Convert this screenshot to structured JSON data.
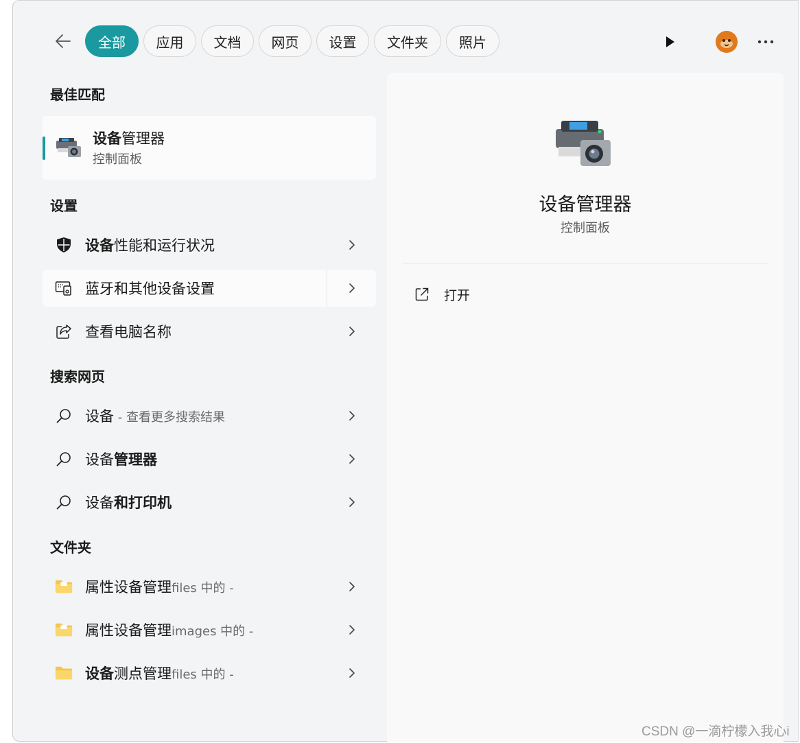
{
  "nav": {
    "filters": [
      "全部",
      "应用",
      "文档",
      "网页",
      "设置",
      "文件夹",
      "照片"
    ],
    "active_filter": "全部"
  },
  "sections": {
    "best_match": "最佳匹配",
    "settings": "设置",
    "web_search": "搜索网页",
    "folders": "文件夹"
  },
  "best_match": {
    "title_bold": "设备",
    "title_rest": "管理器",
    "subtitle": "控制面板"
  },
  "settings_items": [
    {
      "bold": "设备",
      "rest": "性能和运行状况",
      "icon": "shield-icon"
    },
    {
      "bold": "",
      "rest": "蓝牙和其他设备设置",
      "icon": "devices-icon"
    },
    {
      "bold": "",
      "rest": "查看电脑名称",
      "icon": "share-icon"
    }
  ],
  "web_items": [
    {
      "pre": "设备",
      "bold": "",
      "muted": " - 查看更多搜索结果"
    },
    {
      "pre": "设备",
      "bold": "管理器",
      "muted": ""
    },
    {
      "pre": "设备",
      "bold": "和打印机",
      "muted": ""
    }
  ],
  "folder_items": [
    {
      "bold": "",
      "rest": "属性设备管理",
      "suffix": "files 中的 -"
    },
    {
      "bold": "",
      "rest": "属性设备管理",
      "suffix": "images 中的 -"
    },
    {
      "bold": "设备",
      "rest": "测点管理",
      "suffix": "files 中的 -"
    }
  ],
  "detail": {
    "title": "设备管理器",
    "subtitle": "控制面板",
    "action_open": "打开"
  },
  "watermark": "CSDN @一滴柠檬入我心i",
  "colors": {
    "accent": "#1a9aa0",
    "panel_bg": "#f9f9f9",
    "window_bg": "#f3f4f5"
  }
}
